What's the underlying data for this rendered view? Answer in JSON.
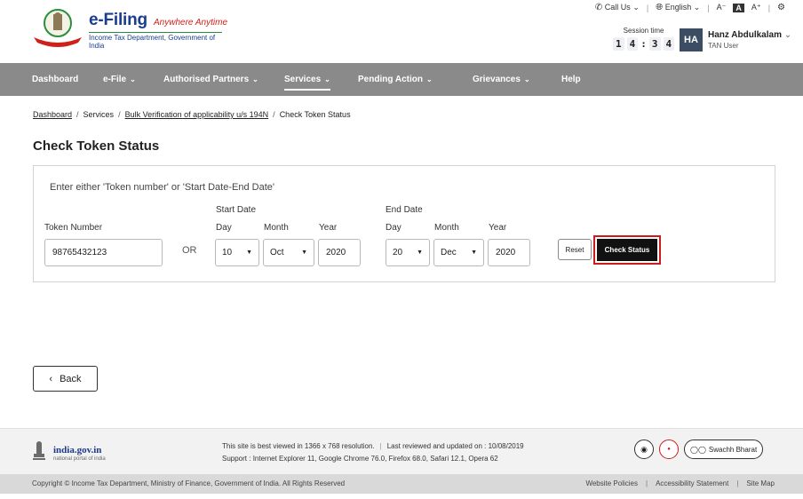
{
  "header": {
    "brand_title": "e-Filing",
    "brand_tagline": "Anywhere Anytime",
    "brand_subtitle": "Income Tax Department, Government of India",
    "call_us": "Call Us",
    "language": "English",
    "font_decrease": "A⁻",
    "font_reset": "A",
    "font_increase": "A⁺",
    "session_label": "Session time",
    "session_digits": [
      "1",
      "4",
      "3",
      "4"
    ],
    "user_initials": "HA",
    "user_name": "Hanz Abdulkalam",
    "user_role": "TAN User"
  },
  "nav": {
    "items": [
      {
        "label": "Dashboard",
        "chevron": false
      },
      {
        "label": "e-File",
        "chevron": true
      },
      {
        "label": "Authorised Partners",
        "chevron": true
      },
      {
        "label": "Services",
        "chevron": true,
        "active": true
      },
      {
        "label": "Pending Action",
        "chevron": true
      },
      {
        "label": "Grievances",
        "chevron": true
      },
      {
        "label": "Help",
        "chevron": false
      }
    ]
  },
  "breadcrumb": {
    "items": [
      "Dashboard",
      "Services",
      "Bulk Verification of applicability u/s 194N",
      "Check Token Status"
    ]
  },
  "page_title": "Check Token Status",
  "form": {
    "hint": "Enter either 'Token number' or 'Start Date-End Date'",
    "token_label": "Token Number",
    "token_value": "98765432123",
    "or_label": "OR",
    "start_group": "Start Date",
    "end_group": "End Date",
    "day_label": "Day",
    "month_label": "Month",
    "year_label": "Year",
    "start_day": "10",
    "start_month": "Oct",
    "start_year": "2020",
    "end_day": "20",
    "end_month": "Dec",
    "end_year": "2020",
    "reset_label": "Reset",
    "check_label": "Check Status"
  },
  "back_label": "Back",
  "footer": {
    "india_name": "india.gov.in",
    "india_sub": "national portal of india",
    "best_viewed": "This site is best viewed in 1366 x 768 resolution.",
    "last_reviewed": "Last reviewed and updated on : 10/08/2019",
    "support": "Support : Internet Explorer 11, Google Chrome 76.0,  Firefox 68.0, Safari 12.1, Opera 62",
    "badge_text": "Swachh Bharat",
    "copyright": "Copyright © Income Tax Department, Ministry of Finance, Government of India. All Rights Reserved",
    "links": [
      "Website Policies",
      "Accessibility Statement",
      "Site Map"
    ]
  },
  "colors": {
    "nav_bg": "#8a8a8a",
    "brand_blue": "#1a3d8f",
    "highlight_red": "#d11a1a",
    "primary_button": "#111111"
  }
}
